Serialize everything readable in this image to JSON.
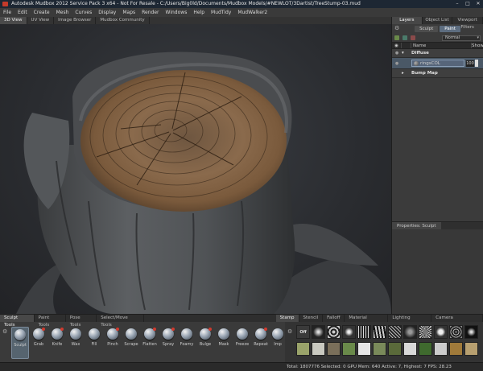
{
  "window": {
    "title": "Autodesk Mudbox 2012 Service Pack 3 x64 - Not For Resale - C:/Users/Big0ld/Documents/Mudbox Models/#NEWLOT/3Dartist/TreeStump-03.mud",
    "controls": [
      "–",
      "□",
      "✕"
    ]
  },
  "menu": [
    "File",
    "Edit",
    "Create",
    "Mesh",
    "Curves",
    "Display",
    "Maps",
    "Render",
    "Windows",
    "Help",
    "MudTidy",
    "MudWalker2"
  ],
  "view_tabs": [
    {
      "label": "3D View",
      "active": true
    },
    {
      "label": "UV View",
      "active": false
    },
    {
      "label": "Image Browser",
      "active": false
    },
    {
      "label": "Mudbox Community",
      "active": false
    }
  ],
  "panel": {
    "tabs": [
      {
        "label": "Layers",
        "active": true
      },
      {
        "label": "Object List",
        "active": false
      },
      {
        "label": "Viewport Filters",
        "active": false
      }
    ],
    "subtabs": [
      {
        "label": "Sculpt",
        "active": false
      },
      {
        "label": "Paint",
        "active": true
      }
    ],
    "blend_mode": "Normal",
    "columns": {
      "name": "Name",
      "show": "Show"
    },
    "layers": [
      {
        "label": "Diffuse",
        "kind": "group"
      },
      {
        "label": "ringsCOL",
        "kind": "layer",
        "opacity": "100"
      },
      {
        "label": "Bump Map",
        "kind": "group"
      }
    ],
    "properties_tab": "Properties: Sculpt"
  },
  "tray": {
    "left_tabs": [
      {
        "label": "Sculpt Tools",
        "active": true
      },
      {
        "label": "Paint Tools",
        "active": false
      },
      {
        "label": "Pose Tools",
        "active": false
      },
      {
        "label": "Select/Move Tools",
        "active": false
      }
    ],
    "right_tabs": [
      {
        "label": "Stamp",
        "active": true
      },
      {
        "label": "Stencil",
        "active": false
      },
      {
        "label": "Falloff",
        "active": false
      },
      {
        "label": "Material Presets",
        "active": false
      },
      {
        "label": "Lighting Presets",
        "active": false
      },
      {
        "label": "Camera Bookmarks",
        "active": false
      }
    ],
    "tools": [
      "Sculpt",
      "Grab",
      "Knife",
      "Wax",
      "Fill",
      "Pinch",
      "Scrape",
      "Flatten",
      "Spray",
      "Foamy",
      "Bulge",
      "Mask",
      "Freeze",
      "Repeat",
      "Imp"
    ],
    "active_tool": "Sculpt",
    "stamp_off_label": "Off"
  },
  "status": "Total: 1807776  Selected: 0  GPU Mem: 640  Active: 7, Highest: 7  FPS: 28.23",
  "colors": {
    "accent": "#5d6d80",
    "tool_dot": "#d03a2e",
    "wood_light": "#8a6a4c",
    "bark": "#55585b"
  }
}
